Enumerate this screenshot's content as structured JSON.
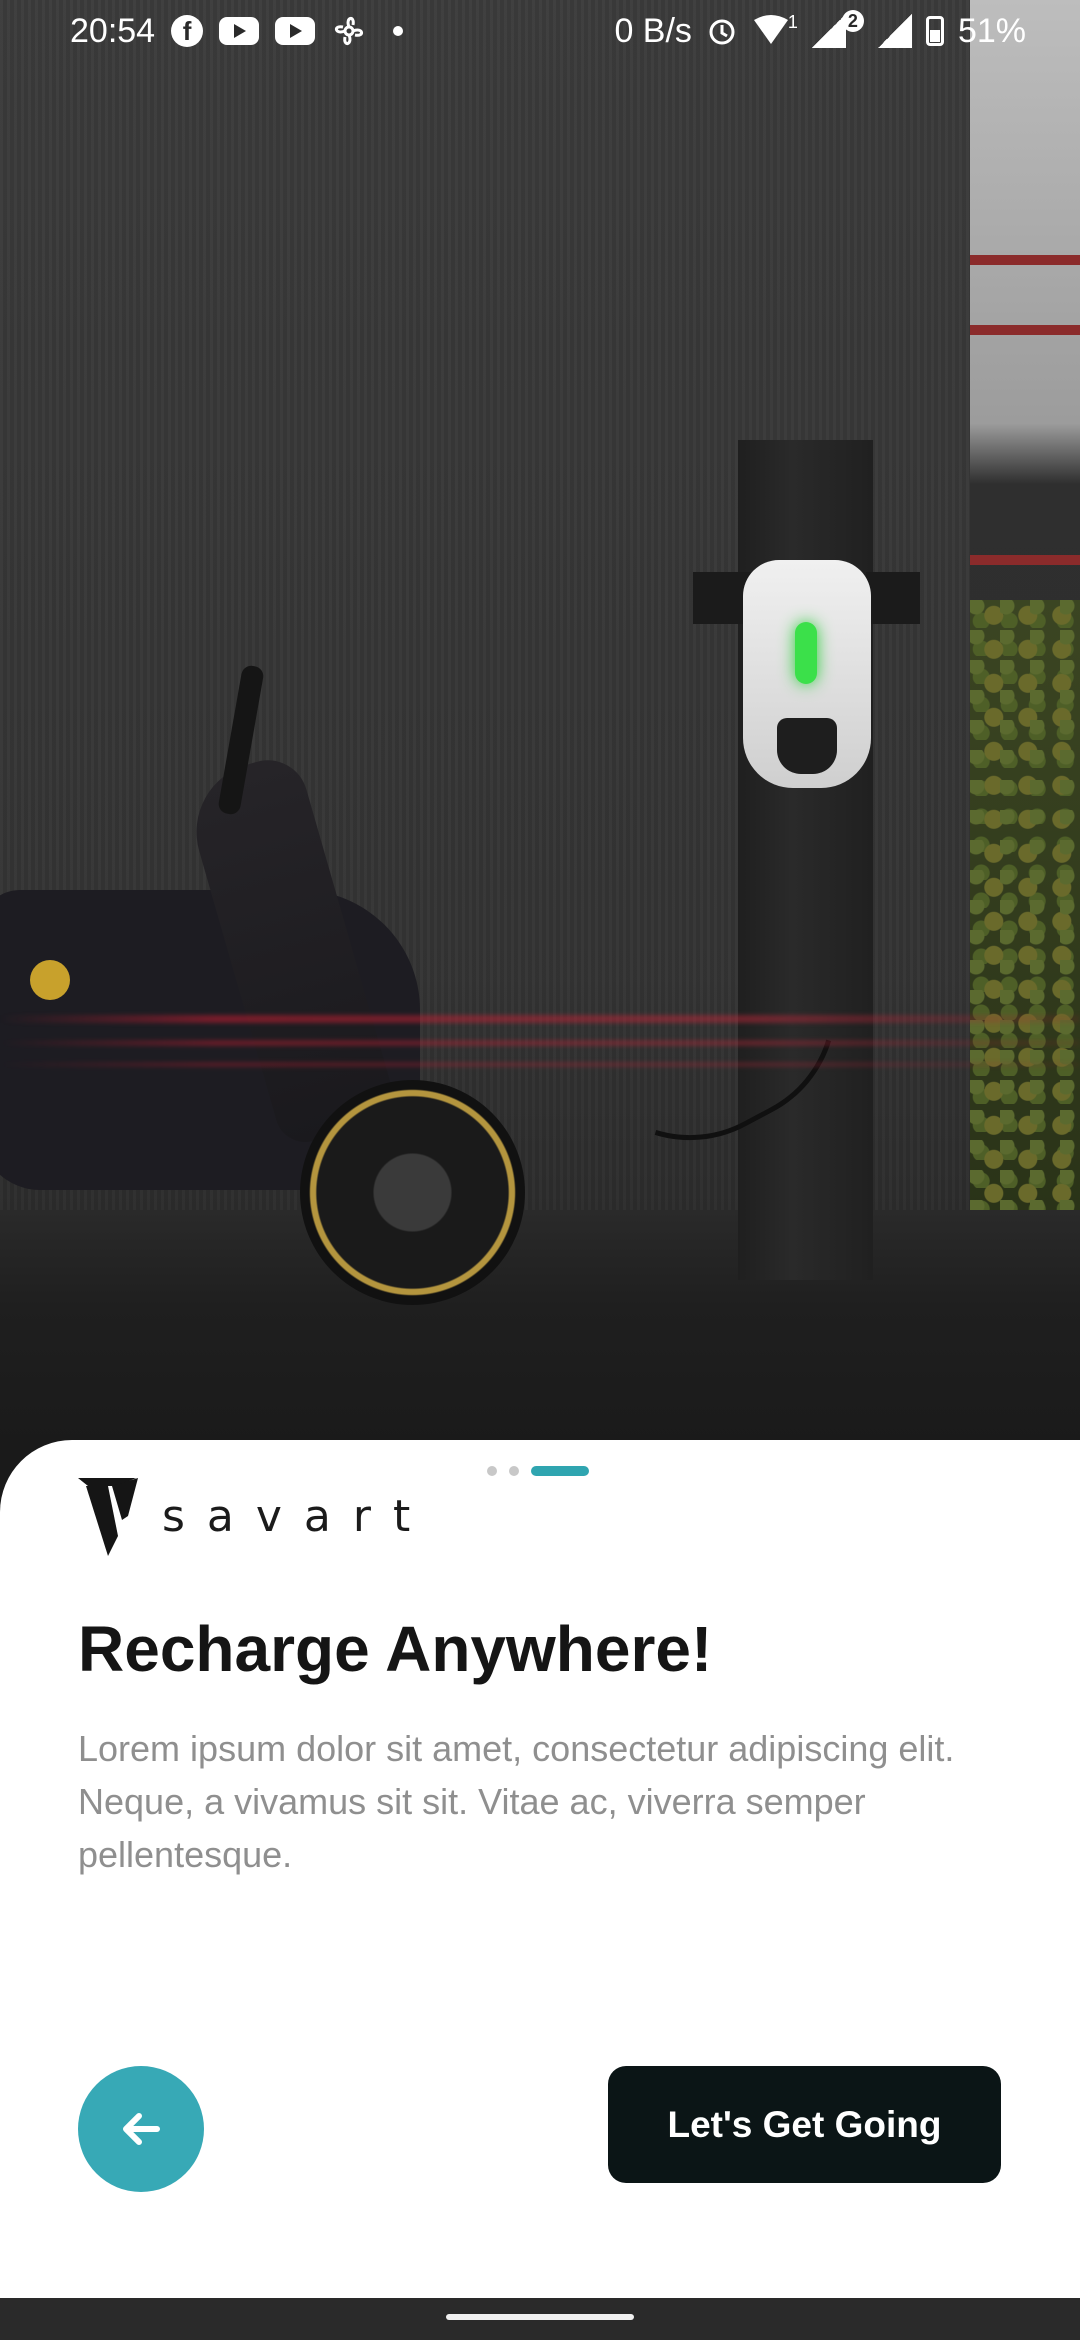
{
  "status_bar": {
    "time": "20:54",
    "net_speed": "0 B/s",
    "battery": "51%",
    "icons": [
      "facebook-icon",
      "youtube-icon",
      "youtube-icon",
      "fan-icon",
      "dot-icon",
      "alarm-icon",
      "wifi-icon",
      "signal-icon",
      "signal-icon",
      "battery-icon"
    ],
    "wifi_badge": "1",
    "sim_badge": "2"
  },
  "onboarding": {
    "brand": "savart",
    "title": "Recharge Anywhere!",
    "description": "Lorem ipsum dolor sit amet, consectetur adipiscing elit. Neque, a vivamus sit sit. Vitae ac, viverra semper pellentesque.",
    "page_count": 3,
    "active_page": 3,
    "cta_label": "Let's Get Going",
    "accent_color": "#37a9b6",
    "cta_color": "#0b1516"
  }
}
